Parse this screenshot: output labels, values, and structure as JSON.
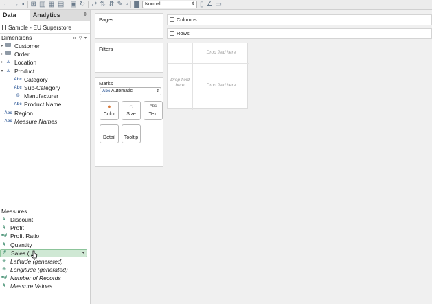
{
  "toolbar": {
    "zoom_value": "Normal"
  },
  "tabs": {
    "data": "Data",
    "analytics": "Analytics"
  },
  "datasource": "Sample - EU Superstore",
  "dimensions": {
    "header": "Dimensions",
    "items": [
      {
        "label": "Customer",
        "icon": "folder-icon",
        "caret": "▸",
        "indent": 0
      },
      {
        "label": "Order",
        "icon": "folder-icon",
        "caret": "▸",
        "indent": 0
      },
      {
        "label": "Location",
        "icon": "person-icon",
        "caret": "▸",
        "indent": 0
      },
      {
        "label": "Product",
        "icon": "person-icon",
        "caret": "▾",
        "indent": 0
      },
      {
        "label": "Category",
        "icon": "abc-icon",
        "caret": "",
        "indent": 1
      },
      {
        "label": "Sub-Category",
        "icon": "abc-icon",
        "caret": "",
        "indent": 1
      },
      {
        "label": "Manufacturer",
        "icon": "hierarchy-icon",
        "caret": "",
        "indent": 1
      },
      {
        "label": "Product Name",
        "icon": "abc-icon",
        "caret": "",
        "indent": 1
      },
      {
        "label": "Region",
        "icon": "abc-icon",
        "caret": "",
        "indent": 0
      },
      {
        "label": "Measure Names",
        "icon": "abc-icon",
        "caret": "",
        "indent": 0,
        "italic": true
      }
    ]
  },
  "measures": {
    "header": "Measures",
    "items": [
      {
        "label": "Discount",
        "icon": "hash-icon"
      },
      {
        "label": "Profit",
        "icon": "hash-icon"
      },
      {
        "label": "Profit Ratio",
        "icon": "calc-icon"
      },
      {
        "label": "Quantity",
        "icon": "hash-icon"
      },
      {
        "label": "Sales (",
        "icon": "hash-icon",
        "highlight": true
      },
      {
        "label": "Latitude (generated)",
        "icon": "globe-icon",
        "italic": true
      },
      {
        "label": "Longitude (generated)",
        "icon": "globe-icon",
        "italic": true
      },
      {
        "label": "Number of Records",
        "icon": "calc-icon",
        "italic": true
      },
      {
        "label": "Measure Values",
        "icon": "hash-icon",
        "italic": true
      }
    ]
  },
  "cards": {
    "pages": "Pages",
    "filters": "Filters",
    "marks": "Marks"
  },
  "shelves": {
    "columns": "Columns",
    "rows": "Rows"
  },
  "marks": {
    "type_value": "Automatic",
    "buttons": {
      "color": "Color",
      "size": "Size",
      "text": "Text",
      "detail": "Detail",
      "tooltip": "Tooltip"
    }
  },
  "view": {
    "drop_field": "Drop field here",
    "drop_field_short": "Drop field here"
  }
}
